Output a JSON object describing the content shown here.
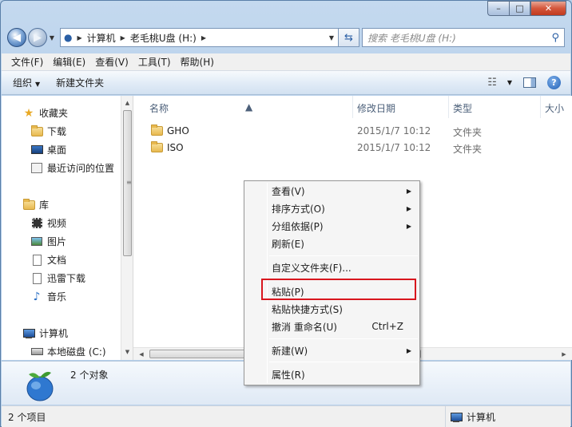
{
  "window": {
    "caption": {
      "minimize": "–",
      "maximize": "□",
      "close": "✕"
    }
  },
  "address": {
    "crumbs": [
      "计算机",
      "老毛桃U盘 (H:)"
    ],
    "search_placeholder": "搜索 老毛桃U盘 (H:)"
  },
  "menubar": [
    "文件(F)",
    "编辑(E)",
    "查看(V)",
    "工具(T)",
    "帮助(H)"
  ],
  "cmdbar": {
    "organize": "组织",
    "new_folder": "新建文件夹"
  },
  "navpane": {
    "favorites": "收藏夹",
    "downloads": "下载",
    "desktop": "桌面",
    "recent": "最近访问的位置",
    "libraries": "库",
    "videos": "视频",
    "pictures": "图片",
    "documents": "文档",
    "thunder": "迅雷下载",
    "music": "音乐",
    "computer": "计算机",
    "local_disk": "本地磁盘 (C:)"
  },
  "columns": {
    "name": "名称",
    "date": "修改日期",
    "type": "类型",
    "size": "大小"
  },
  "files": [
    {
      "name": "GHO",
      "date": "2015/1/7 10:12",
      "type": "文件夹"
    },
    {
      "name": "ISO",
      "date": "2015/1/7 10:12",
      "type": "文件夹"
    }
  ],
  "details": {
    "count": "2 个对象"
  },
  "statusbar": {
    "items": "2 个项目",
    "location": "计算机"
  },
  "context_menu": {
    "view": "查看(V)",
    "sort": "排序方式(O)",
    "group": "分组依据(P)",
    "refresh": "刷新(E)",
    "customize": "自定义文件夹(F)...",
    "paste": "粘贴(P)",
    "paste_shortcut": "粘贴快捷方式(S)",
    "undo": "撤消 重命名(U)",
    "undo_shortcut": "Ctrl+Z",
    "new": "新建(W)",
    "properties": "属性(R)"
  },
  "colors": {
    "highlight_box": "#d8161e",
    "accent": "#2a5fa5"
  }
}
